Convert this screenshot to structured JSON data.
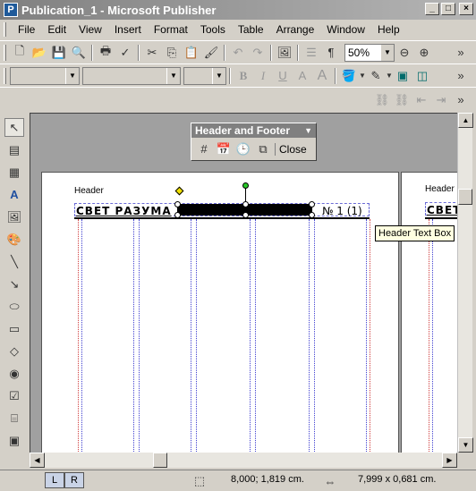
{
  "window": {
    "title": "Publication_1 - Microsoft Publisher",
    "icon": "publisher-icon"
  },
  "menu": [
    {
      "label": "File"
    },
    {
      "label": "Edit"
    },
    {
      "label": "View"
    },
    {
      "label": "Insert"
    },
    {
      "label": "Format"
    },
    {
      "label": "Tools"
    },
    {
      "label": "Table"
    },
    {
      "label": "Arrange"
    },
    {
      "label": "Window"
    },
    {
      "label": "Help"
    }
  ],
  "standard_toolbar": {
    "zoom": "50%"
  },
  "formatting_toolbar": {
    "style": "",
    "font": "",
    "size": ""
  },
  "hf_toolbar": {
    "title": "Header and Footer",
    "close_label": "Close"
  },
  "page1": {
    "header_label": "Header",
    "header_text": "СВЕТ РАЗУМА",
    "header_number": "№ 1 (1)"
  },
  "page2": {
    "header_label": "Header",
    "header_text": "СВЕТ"
  },
  "tooltip": "Header Text Box",
  "status": {
    "page_left": "L",
    "page_right": "R",
    "position": "8,000; 1,819 cm.",
    "size": "7,999 x  0,681 cm."
  }
}
